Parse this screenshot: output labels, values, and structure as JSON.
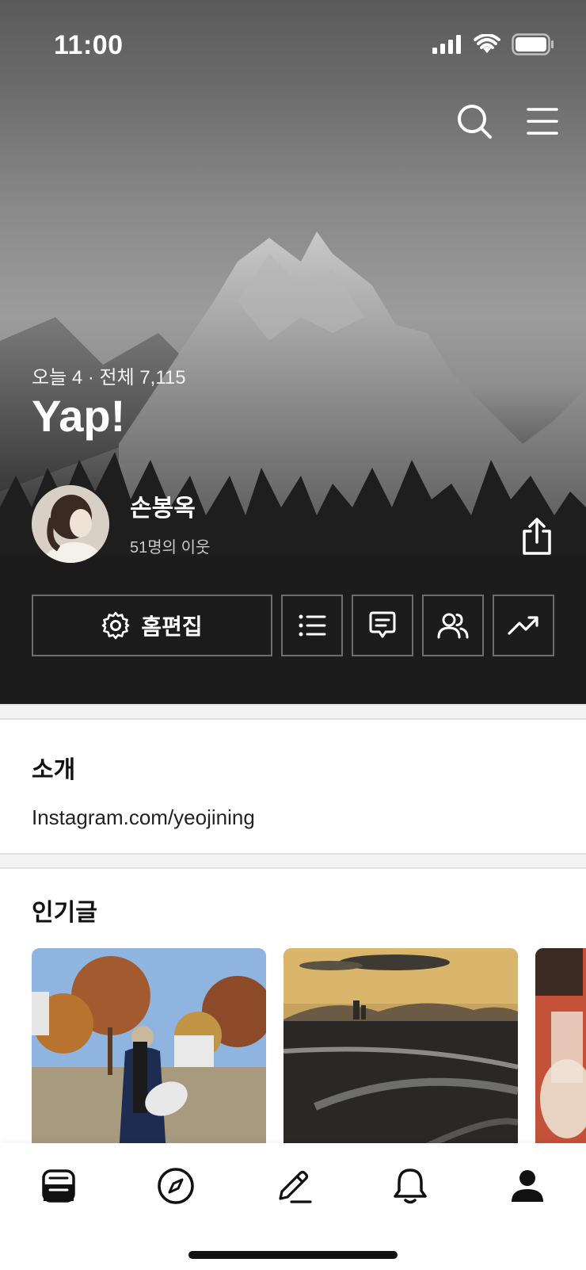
{
  "status_bar": {
    "time": "11:00"
  },
  "blog": {
    "visit_count": "오늘 4 · 전체 7,115",
    "title": "Yap!",
    "owner_name": "손봉옥",
    "neighbors": "51명의 이웃"
  },
  "actions": {
    "edit_label": "홈편집"
  },
  "intro": {
    "title": "소개",
    "text": "Instagram.com/yeojining"
  },
  "popular": {
    "title": "인기글"
  },
  "colors": {
    "hero_dark": "#1c1c1c",
    "accent_text": "#ffffff"
  },
  "icons": {
    "top": [
      "search-icon",
      "menu-icon"
    ],
    "actions": [
      "gear-icon",
      "list-icon",
      "comment-icon",
      "people-icon",
      "trend-icon"
    ],
    "nav": [
      "feed-icon",
      "compass-icon",
      "pencil-icon",
      "bell-icon",
      "person-icon"
    ]
  }
}
